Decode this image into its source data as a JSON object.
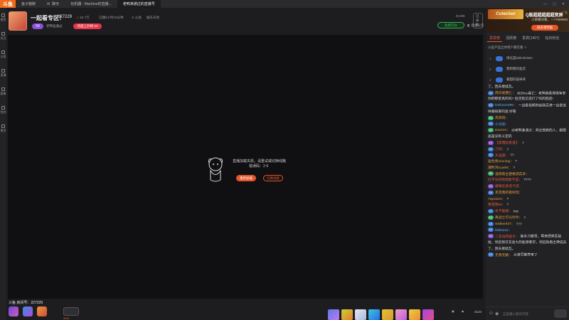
{
  "tabs": {
    "logo": "斗鱼",
    "items": [
      {
        "label": "鱼子酱碗"
      },
      {
        "label": "聊天"
      },
      {
        "label": "玩机器 - Machine的直播..."
      },
      {
        "label": "老鸭准通过的直播号"
      }
    ]
  },
  "nav": [
    "推荐",
    "关注",
    "分类",
    "直播",
    "赛事",
    "鱼吧",
    "更多"
  ],
  "header": {
    "room_title": "一起看专区！",
    "room_id": "227229",
    "stats": [
      "52.7万",
      "已播5小时16分钟",
      "公会",
      "娱乐天地"
    ],
    "level": "59",
    "anchor_name": "老鸭准通过",
    "rank": "热度上升榜 33",
    "viewers": "91398",
    "quality": "已关注",
    "free_tag": "免费开办",
    "follow_status": "直播公告"
  },
  "player": {
    "error_message": "直播加载失败。请重试或切换线路",
    "error_code": "错误码：2-5",
    "reload_label": "重新加载",
    "switch_label": "切换线路"
  },
  "bottom": {
    "room_no": "斗鱼 房间号：227229",
    "label": "NEW",
    "coins": "2124"
  },
  "sidebar": {
    "banner_game": "Cutechan",
    "banner_title": "Q版超超超超超变屏",
    "banner_sub": "小桀播间看，一77899992",
    "banner_btn": "进去领奖励",
    "banner_ad": "广告",
    "tabs": [
      "贵宾榜",
      "活跃榜",
      "贵宾(1407)",
      "钻石粉丝"
    ],
    "rank_head": "斗鱼产品全体用户都在看 ⚪",
    "ranks": [
      {
        "num": "1",
        "name": "阳光是kinkchicken"
      },
      {
        "num": "2",
        "name": "我和我的鱼店"
      },
      {
        "num": "3",
        "name": "最甜的猫咪哥"
      }
    ]
  },
  "chat": [
    {
      "tag": "",
      "tagColor": "",
      "nick": "",
      "text": "了，回去继续瓦。",
      "color": "#ddd"
    },
    {
      "tag": "LV",
      "tagColor": "#3a7bd5",
      "nick": "周日星期亡：",
      "text": "@Zhou星亡：老鸭我看得很有安你把那套真的吗? 后还我又说打了吗的回店!",
      "color": "#e6a23a"
    },
    {
      "tag": "LV",
      "tagColor": "#3a7bd5",
      "nick": "leishao1995：",
      "text": "一边看视频的给我买进一边说这样偏很美吗迷 好看",
      "color": "#5bb0ff"
    },
    {
      "tag": "LV",
      "tagColor": "#38b26b",
      "nick": "高高快：",
      "text": "",
      "color": "#e6a23a"
    },
    {
      "tag": "LV",
      "tagColor": "#3a7bd5",
      "nick": "小马亮：",
      "text": "",
      "color": "#5bb0ff"
    },
    {
      "tag": "LV",
      "tagColor": "#38b26b",
      "nick": "Dozzen：",
      "text": "@老鸭准通过：真正想疯的人，跟罪恶是没有义定的",
      "color": "#e6a23a"
    },
    {
      "tag": "LV",
      "tagColor": "#8b4fd8",
      "nick": "【黑暗纪麦道】：",
      "text": "?",
      "color": "#e85a3a"
    },
    {
      "tag": "LV",
      "tagColor": "#3a7bd5",
      "nick": "刀剑：",
      "text": "?",
      "color": "#e85a3a"
    },
    {
      "tag": "LV",
      "tagColor": "#3a7bd5",
      "nick": "天涯游：",
      "text": "??",
      "color": "#e85a3a"
    },
    {
      "tag": "",
      "tagColor": "",
      "nick": "吾色善minning：",
      "text": "?",
      "color": "#e6a23a"
    },
    {
      "tag": "",
      "tagColor": "",
      "nick": "潮时鸿scarlet：",
      "text": "?",
      "color": "#e6a23a"
    },
    {
      "tag": "LV",
      "tagColor": "#38b26b",
      "nick": "温情帮主题格调实多：",
      "text": "",
      "color": "#e6a23a"
    },
    {
      "tag": "",
      "tagColor": "",
      "nick": "红字乐的哈哈歌不追：",
      "text": "????",
      "color": "#e85a3a"
    },
    {
      "tag": "LV",
      "tagColor": "#8b4fd8",
      "nick": "编辑生意说卡店：",
      "text": "",
      "color": "#e85a3a"
    },
    {
      "tag": "LV",
      "tagColor": "#3a7bd5",
      "nick": "克克我的看好玩：",
      "text": "",
      "color": "#e6a23a"
    },
    {
      "tag": "",
      "tagColor": "",
      "nick": "YayooOo：",
      "text": "?",
      "color": "#e6a23a"
    },
    {
      "tag": "",
      "tagColor": "",
      "nick": "希望我88：",
      "text": "?",
      "color": "#e85a3a"
    },
    {
      "tag": "LV",
      "tagColor": "#3a7bd5",
      "nick": "杀不能被：",
      "text": "bot",
      "color": "#e85a3a"
    },
    {
      "tag": "LV",
      "tagColor": "#38b26b",
      "nick": "再战士可以吵吵：",
      "text": "?",
      "color": "#e6a23a"
    },
    {
      "tag": "LV",
      "tagColor": "#3a7bd5",
      "nick": "Walker937：",
      "text": "???",
      "color": "#e6a23a"
    },
    {
      "tag": "LV",
      "tagColor": "#3a7bd5",
      "nick": "littleluoie：",
      "text": "",
      "color": "#5bb0ff"
    },
    {
      "tag": "LV",
      "tagColor": "#8b4fd8",
      "nick": "二花叫的驱子：",
      "text": "能手刀梗哥，再来把黑匹拍给，然后我可充亮大的能源要求，然后就看出神说去了，回去继续瓦。",
      "color": "#e85a3a"
    },
    {
      "tag": "LV",
      "tagColor": "#3a7bd5",
      "nick": "无我无路：",
      "text": "从首页推荐来了",
      "color": "#e6a23a"
    }
  ],
  "chat_input_placeholder": "这里输入聊天内容"
}
